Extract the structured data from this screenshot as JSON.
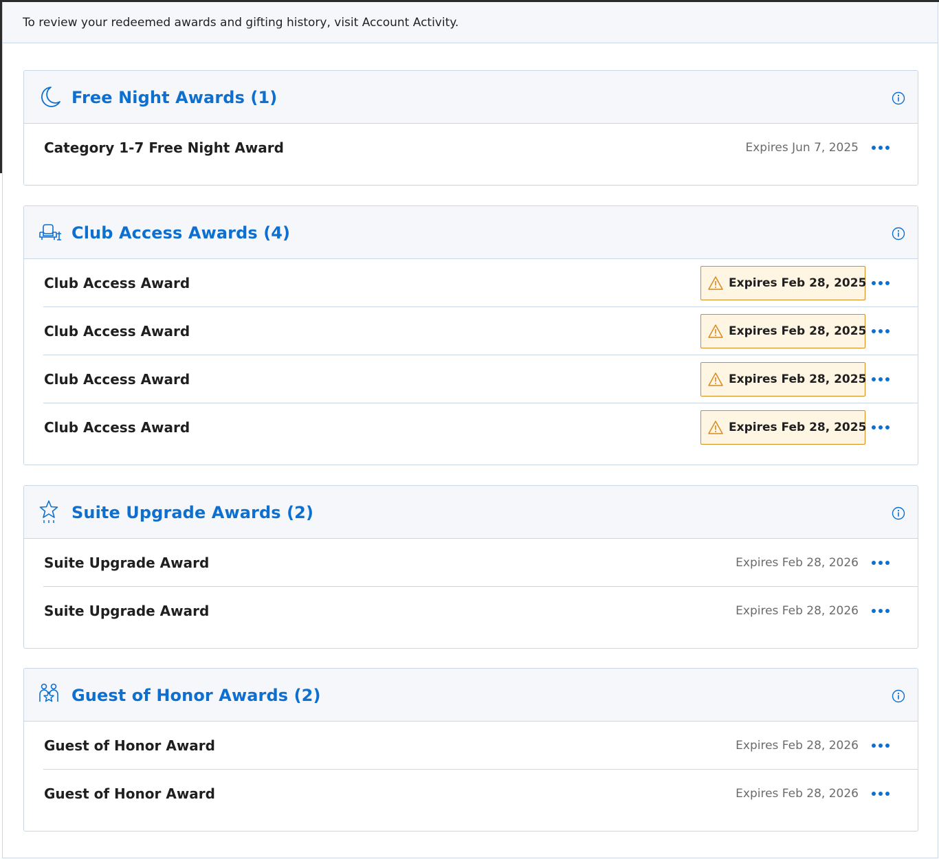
{
  "notice": {
    "text": "To review your redeemed awards and gifting history, visit Account Activity."
  },
  "colors": {
    "accent": "#0d6fd0",
    "warning_border": "#d98a1e",
    "warning_bg": "#fff5e3"
  },
  "sections": [
    {
      "icon": "moon-icon",
      "title": "Free Night Awards (1)",
      "rows": [
        {
          "name": "Category 1-7 Free Night Award",
          "expiry": "Expires Jun 7, 2025",
          "warning": false
        }
      ]
    },
    {
      "icon": "armchair-icon",
      "title": "Club Access Awards (4)",
      "rows": [
        {
          "name": "Club Access Award",
          "expiry": "Expires Feb 28, 2025",
          "warning": true
        },
        {
          "name": "Club Access Award",
          "expiry": "Expires Feb 28, 2025",
          "warning": true
        },
        {
          "name": "Club Access Award",
          "expiry": "Expires Feb 28, 2025",
          "warning": true
        },
        {
          "name": "Club Access Award",
          "expiry": "Expires Feb 28, 2025",
          "warning": true
        }
      ]
    },
    {
      "icon": "star-icon",
      "title": "Suite Upgrade Awards (2)",
      "rows": [
        {
          "name": "Suite Upgrade Award",
          "expiry": "Expires Feb 28, 2026",
          "warning": false
        },
        {
          "name": "Suite Upgrade Award",
          "expiry": "Expires Feb 28, 2026",
          "warning": false
        }
      ]
    },
    {
      "icon": "guests-icon",
      "title": "Guest of Honor Awards (2)",
      "rows": [
        {
          "name": "Guest of Honor Award",
          "expiry": "Expires Feb 28, 2026",
          "warning": false
        },
        {
          "name": "Guest of Honor Award",
          "expiry": "Expires Feb 28, 2026",
          "warning": false
        }
      ]
    }
  ]
}
